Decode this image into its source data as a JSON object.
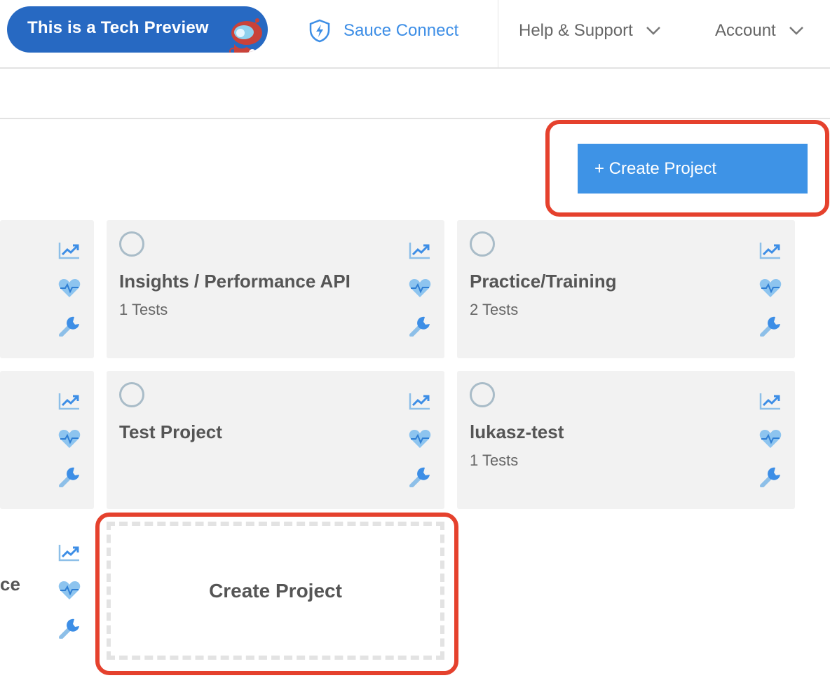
{
  "header": {
    "tech_preview": "This is a Tech Preview",
    "sauce_connect": "Sauce Connect",
    "help_support": "Help & Support",
    "account": "Account"
  },
  "actions": {
    "create_project_button": "+ Create Project",
    "create_project_tile": "Create Project"
  },
  "projects": [
    {
      "title": "",
      "tests": ""
    },
    {
      "title": "Insights / Performance API",
      "tests": "1 Tests"
    },
    {
      "title": "Practice/Training",
      "tests": "2 Tests"
    },
    {
      "title": "",
      "tests": ""
    },
    {
      "title": "Test Project",
      "tests": ""
    },
    {
      "title": "lukasz-test",
      "tests": "1 Tests"
    },
    {
      "title": "ce",
      "tests": ""
    }
  ],
  "icons": [
    "shield-bolt-icon",
    "chevron-down-icon",
    "trend-chart-icon",
    "heartbeat-icon",
    "wrench-icon",
    "status-circle-icon",
    "mascot-icon"
  ],
  "colors": {
    "brand_blue": "#2769c2",
    "link_blue": "#3d8ee6",
    "button_blue": "#3e93e6",
    "highlight_red": "#e5412d",
    "card_bg": "#f2f2f2"
  }
}
